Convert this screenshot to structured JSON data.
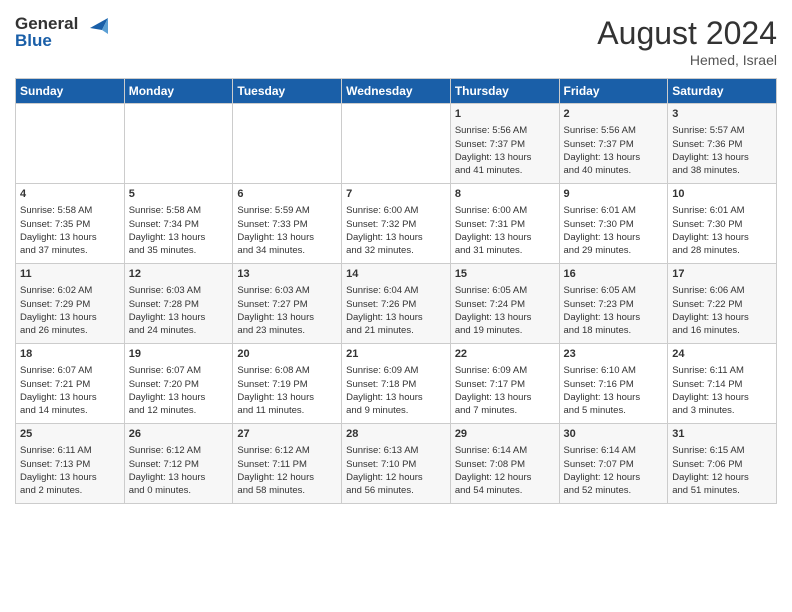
{
  "header": {
    "logo_line1": "General",
    "logo_line2": "Blue",
    "month_year": "August 2024",
    "location": "Hemed, Israel"
  },
  "weekdays": [
    "Sunday",
    "Monday",
    "Tuesday",
    "Wednesday",
    "Thursday",
    "Friday",
    "Saturday"
  ],
  "weeks": [
    [
      {
        "day": "",
        "info": ""
      },
      {
        "day": "",
        "info": ""
      },
      {
        "day": "",
        "info": ""
      },
      {
        "day": "",
        "info": ""
      },
      {
        "day": "1",
        "info": "Sunrise: 5:56 AM\nSunset: 7:37 PM\nDaylight: 13 hours\nand 41 minutes."
      },
      {
        "day": "2",
        "info": "Sunrise: 5:56 AM\nSunset: 7:37 PM\nDaylight: 13 hours\nand 40 minutes."
      },
      {
        "day": "3",
        "info": "Sunrise: 5:57 AM\nSunset: 7:36 PM\nDaylight: 13 hours\nand 38 minutes."
      }
    ],
    [
      {
        "day": "4",
        "info": "Sunrise: 5:58 AM\nSunset: 7:35 PM\nDaylight: 13 hours\nand 37 minutes."
      },
      {
        "day": "5",
        "info": "Sunrise: 5:58 AM\nSunset: 7:34 PM\nDaylight: 13 hours\nand 35 minutes."
      },
      {
        "day": "6",
        "info": "Sunrise: 5:59 AM\nSunset: 7:33 PM\nDaylight: 13 hours\nand 34 minutes."
      },
      {
        "day": "7",
        "info": "Sunrise: 6:00 AM\nSunset: 7:32 PM\nDaylight: 13 hours\nand 32 minutes."
      },
      {
        "day": "8",
        "info": "Sunrise: 6:00 AM\nSunset: 7:31 PM\nDaylight: 13 hours\nand 31 minutes."
      },
      {
        "day": "9",
        "info": "Sunrise: 6:01 AM\nSunset: 7:30 PM\nDaylight: 13 hours\nand 29 minutes."
      },
      {
        "day": "10",
        "info": "Sunrise: 6:01 AM\nSunset: 7:30 PM\nDaylight: 13 hours\nand 28 minutes."
      }
    ],
    [
      {
        "day": "11",
        "info": "Sunrise: 6:02 AM\nSunset: 7:29 PM\nDaylight: 13 hours\nand 26 minutes."
      },
      {
        "day": "12",
        "info": "Sunrise: 6:03 AM\nSunset: 7:28 PM\nDaylight: 13 hours\nand 24 minutes."
      },
      {
        "day": "13",
        "info": "Sunrise: 6:03 AM\nSunset: 7:27 PM\nDaylight: 13 hours\nand 23 minutes."
      },
      {
        "day": "14",
        "info": "Sunrise: 6:04 AM\nSunset: 7:26 PM\nDaylight: 13 hours\nand 21 minutes."
      },
      {
        "day": "15",
        "info": "Sunrise: 6:05 AM\nSunset: 7:24 PM\nDaylight: 13 hours\nand 19 minutes."
      },
      {
        "day": "16",
        "info": "Sunrise: 6:05 AM\nSunset: 7:23 PM\nDaylight: 13 hours\nand 18 minutes."
      },
      {
        "day": "17",
        "info": "Sunrise: 6:06 AM\nSunset: 7:22 PM\nDaylight: 13 hours\nand 16 minutes."
      }
    ],
    [
      {
        "day": "18",
        "info": "Sunrise: 6:07 AM\nSunset: 7:21 PM\nDaylight: 13 hours\nand 14 minutes."
      },
      {
        "day": "19",
        "info": "Sunrise: 6:07 AM\nSunset: 7:20 PM\nDaylight: 13 hours\nand 12 minutes."
      },
      {
        "day": "20",
        "info": "Sunrise: 6:08 AM\nSunset: 7:19 PM\nDaylight: 13 hours\nand 11 minutes."
      },
      {
        "day": "21",
        "info": "Sunrise: 6:09 AM\nSunset: 7:18 PM\nDaylight: 13 hours\nand 9 minutes."
      },
      {
        "day": "22",
        "info": "Sunrise: 6:09 AM\nSunset: 7:17 PM\nDaylight: 13 hours\nand 7 minutes."
      },
      {
        "day": "23",
        "info": "Sunrise: 6:10 AM\nSunset: 7:16 PM\nDaylight: 13 hours\nand 5 minutes."
      },
      {
        "day": "24",
        "info": "Sunrise: 6:11 AM\nSunset: 7:14 PM\nDaylight: 13 hours\nand 3 minutes."
      }
    ],
    [
      {
        "day": "25",
        "info": "Sunrise: 6:11 AM\nSunset: 7:13 PM\nDaylight: 13 hours\nand 2 minutes."
      },
      {
        "day": "26",
        "info": "Sunrise: 6:12 AM\nSunset: 7:12 PM\nDaylight: 13 hours\nand 0 minutes."
      },
      {
        "day": "27",
        "info": "Sunrise: 6:12 AM\nSunset: 7:11 PM\nDaylight: 12 hours\nand 58 minutes."
      },
      {
        "day": "28",
        "info": "Sunrise: 6:13 AM\nSunset: 7:10 PM\nDaylight: 12 hours\nand 56 minutes."
      },
      {
        "day": "29",
        "info": "Sunrise: 6:14 AM\nSunset: 7:08 PM\nDaylight: 12 hours\nand 54 minutes."
      },
      {
        "day": "30",
        "info": "Sunrise: 6:14 AM\nSunset: 7:07 PM\nDaylight: 12 hours\nand 52 minutes."
      },
      {
        "day": "31",
        "info": "Sunrise: 6:15 AM\nSunset: 7:06 PM\nDaylight: 12 hours\nand 51 minutes."
      }
    ]
  ]
}
